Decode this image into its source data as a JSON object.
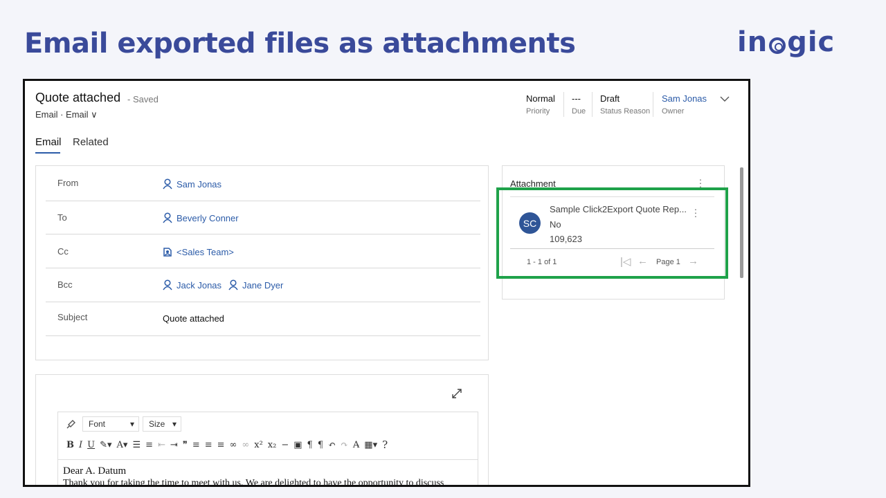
{
  "slide": {
    "title": "Email exported files as attachments",
    "brand": "inogic"
  },
  "record": {
    "title": "Quote attached",
    "saved": "- Saved",
    "subtitle": "Email · Email ∨"
  },
  "header": {
    "priority": {
      "value": "Normal",
      "label": "Priority"
    },
    "due": {
      "value": "---",
      "label": "Due"
    },
    "status": {
      "value": "Draft",
      "label": "Status Reason"
    },
    "owner": {
      "value": "Sam Jonas",
      "label": "Owner"
    }
  },
  "tabs": [
    {
      "label": "Email",
      "active": true
    },
    {
      "label": "Related",
      "active": false
    }
  ],
  "fields": {
    "from": {
      "label": "From",
      "value": "Sam Jonas"
    },
    "to": {
      "label": "To",
      "value": "Beverly Conner"
    },
    "cc": {
      "label": "Cc",
      "value": "<Sales Team>"
    },
    "bcc": {
      "label": "Bcc",
      "value1": "Jack Jonas",
      "value2": "Jane Dyer"
    },
    "subject": {
      "label": "Subject",
      "value": "Quote attached"
    }
  },
  "attachment": {
    "title": "Attachment",
    "avatar": "SC",
    "name": "Sample Click2Export Quote Rep...",
    "line2": "No",
    "line3": "109,623",
    "count": "1 - 1 of 1",
    "page": "Page 1"
  },
  "editor": {
    "font_label": "Font",
    "size_label": "Size",
    "greeting": "Dear A. Datum",
    "body": "Thank you for taking the time to meet with us. We are delighted to have the opportunity to discuss"
  },
  "colors": {
    "brand": "#3a4a9a",
    "link": "#2b5ba8",
    "highlight": "#1fa24a"
  }
}
